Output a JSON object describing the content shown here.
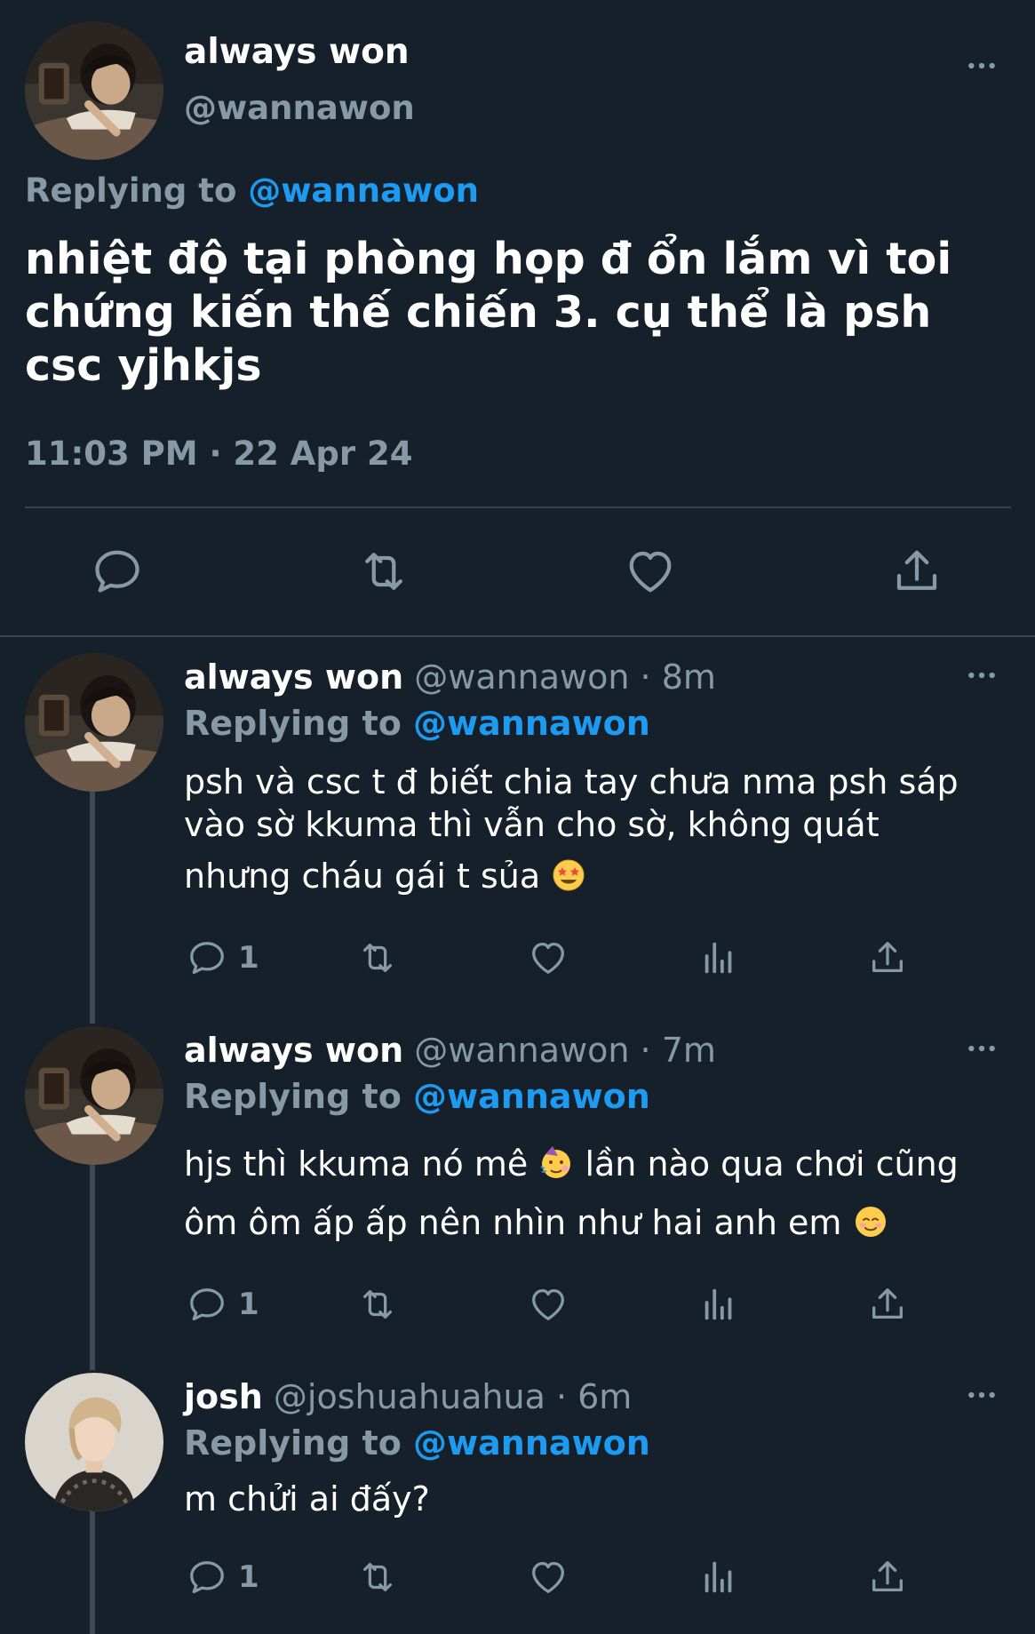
{
  "main_tweet": {
    "name": "always won",
    "handle": "@wannawon",
    "replying_prefix": "Replying to ",
    "replying_handle": "@wannawon",
    "text": "nhiệt độ tại phòng họp đ ổn lắm vì toi chứng kiến thế chiến 3. cụ thể là psh csc yjhkjs",
    "time": "11:03 PM · 22 Apr 24",
    "icons": [
      "more-icon",
      "reply-icon",
      "retweet-icon",
      "like-icon",
      "share-icon"
    ]
  },
  "replies": [
    {
      "name": "always won",
      "meta": "@wannawon · 8m",
      "replying_prefix": "Replying to ",
      "replying_handle": "@wannawon",
      "line1": "psh và csc t đ biết chia tay chưa nma psh sáp",
      "line2": "vào sờ kkuma thì vẫn cho sờ, không quát",
      "line3": "nhưng cháu gái t sủa",
      "emoji1": "star-struck-emoji",
      "reply_count": "1"
    },
    {
      "name": "always won",
      "meta": "@wannawon · 7m",
      "replying_prefix": "Replying to ",
      "replying_handle": "@wannawon",
      "line1_a": "hjs thì kkuma nó mê",
      "line1_b": "lần nào qua chơi cũng",
      "line2": "ôm ôm ấp ấp nên nhìn như hai anh em",
      "emoji1": "partying-face-emoji",
      "emoji2": "smiling-face-emoji",
      "reply_count": "1"
    },
    {
      "name": "josh",
      "meta": "@joshuahuahua · 6m",
      "replying_prefix": "Replying to ",
      "replying_handle": "@wannawon",
      "line1": "m chửi ai đấy?",
      "reply_count": "1"
    }
  ],
  "colors": {
    "background": "#15202b",
    "text": "#ffffff",
    "muted": "#8899a6",
    "link": "#1d9bf0",
    "divider": "#38444d"
  }
}
